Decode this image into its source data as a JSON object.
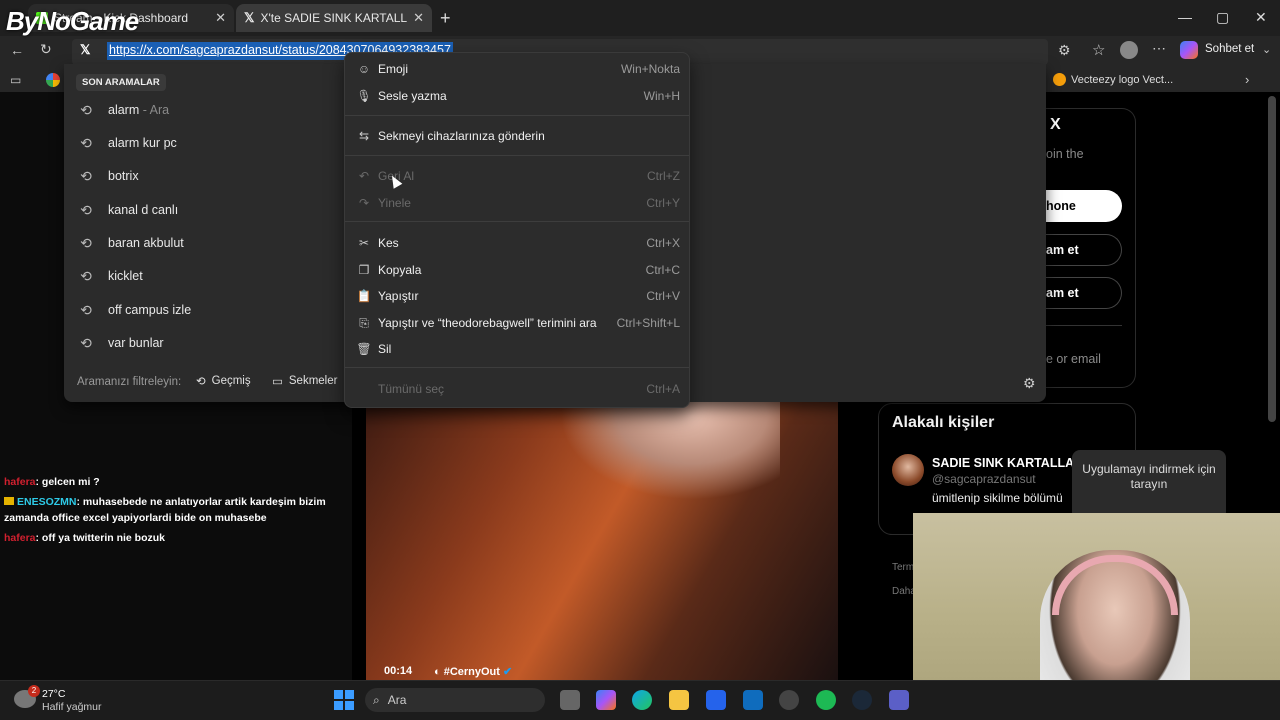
{
  "logo": {
    "text": "ByNoGame"
  },
  "tabs": [
    {
      "label": "Stream - Kick Dashboard",
      "close": "✕"
    },
    {
      "label": "X'te SADIE SINK KARTALLARI‪ms...",
      "close": "✕"
    }
  ],
  "new_tab": "+",
  "window_controls": {
    "minimize": "—",
    "maximize": "▢",
    "close": "✕"
  },
  "address_bar": {
    "url": "https://x.com/sagcaprazdansut/status/2084307064932383457"
  },
  "toolbar": {
    "copilot_label": "Sohbet et"
  },
  "bookmarks": {
    "right_item": "Vecteezy logo Vect..."
  },
  "search_dropdown": {
    "header": "SON ARAMALAR",
    "items": [
      {
        "label": "alarm",
        "suffix": " - Ara"
      },
      {
        "label": "alarm kur pc",
        "suffix": ""
      },
      {
        "label": "botrix",
        "suffix": ""
      },
      {
        "label": "kanal d canlı",
        "suffix": ""
      },
      {
        "label": "baran akbulut",
        "suffix": ""
      },
      {
        "label": "kicklet",
        "suffix": ""
      },
      {
        "label": "off campus izle",
        "suffix": ""
      },
      {
        "label": "var bunlar",
        "suffix": ""
      }
    ],
    "filter_label": "Aramanızı filtreleyin:",
    "filters": [
      "Geçmiş",
      "Sekmeler"
    ]
  },
  "context_menu": {
    "items": [
      {
        "label": "Emoji",
        "shortcut": "Win+Nokta",
        "icon": "emoji-icon",
        "disabled": false
      },
      {
        "label": "Sesle yazma",
        "shortcut": "Win+H",
        "icon": "microphone-icon",
        "disabled": false
      },
      {
        "label": "Sekmeyi cihazlarınıza gönderin",
        "shortcut": "",
        "icon": "send-device-icon",
        "disabled": false
      },
      {
        "label": "Geri Al",
        "shortcut": "Ctrl+Z",
        "icon": "undo-icon",
        "disabled": true
      },
      {
        "label": "Yinele",
        "shortcut": "Ctrl+Y",
        "icon": "redo-icon",
        "disabled": true
      },
      {
        "label": "Kes",
        "shortcut": "Ctrl+X",
        "icon": "scissors-icon",
        "disabled": false
      },
      {
        "label": "Kopyala",
        "shortcut": "Ctrl+C",
        "icon": "copy-icon",
        "disabled": false
      },
      {
        "label": "Yapıştır",
        "shortcut": "Ctrl+V",
        "icon": "paste-icon",
        "disabled": false
      },
      {
        "label": "Yapıştır ve “theodorebagwell” terimini ara",
        "shortcut": "Ctrl+Shift+L",
        "icon": "paste-search-icon",
        "disabled": false
      },
      {
        "label": "Sil",
        "shortcut": "",
        "icon": "trash-icon",
        "disabled": false
      },
      {
        "label": "Tümünü seç",
        "shortcut": "Ctrl+A",
        "icon": "",
        "disabled": true
      }
    ]
  },
  "chat": [
    {
      "user": "hafera",
      "message": ": gelcen mi ?"
    },
    {
      "user": "ENESOZMN",
      "message": ": muhasebede ne anlatıyorlar artik kardeşim bizim zamanda office excel yapiyorlardi bide on muhasebe"
    },
    {
      "user": "hafera",
      "message": ": off ya twitterin nie bozuk"
    }
  ],
  "video": {
    "time": "00:14",
    "tag": "#CernyOut"
  },
  "right_panel": {
    "card_title_fragment": "X",
    "card_text_fragment": "oin the",
    "phone_button": "hone",
    "continue_button_1": "am et",
    "continue_button_2": "am et",
    "email_fragment": "e or email",
    "related_title": "Alakalı kişiler",
    "related_name": "SADIE SINK KARTALLARI",
    "related_handle": "@sagcaprazdansut",
    "related_bio": "ümitlenip sikilme bölümü",
    "qr_text": "Uygulamayı indirmek için tarayın",
    "terms_fragment": "Term",
    "more_fragment": "Daha"
  },
  "taskbar": {
    "weather_badge": "2",
    "temperature": "27°C",
    "weather_desc": "Hafif yağmur",
    "search_placeholder": "Ara"
  },
  "colors": {
    "url_highlight": "#1a5fb4",
    "chat_user_red": "#d2202f",
    "chat_user_cyan": "#2ecbe8"
  }
}
